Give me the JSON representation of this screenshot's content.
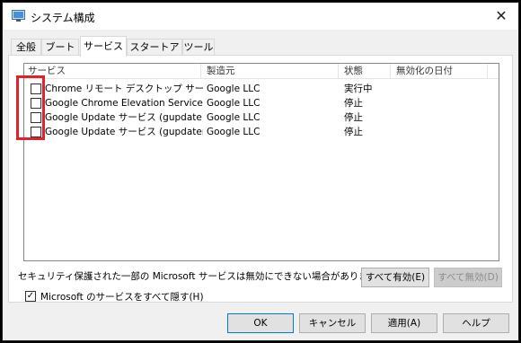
{
  "window": {
    "title": "システム構成"
  },
  "tabs": [
    {
      "label": "全般"
    },
    {
      "label": "ブート"
    },
    {
      "label": "サービス"
    },
    {
      "label": "スタートアップ"
    },
    {
      "label": "ツール"
    }
  ],
  "services": {
    "columns": [
      "サービス",
      "製造元",
      "状態",
      "無効化の日付"
    ],
    "rows": [
      {
        "name": "Chrome リモート デスクトップ サービス",
        "maker": "Google LLC",
        "status": "実行中",
        "disabled_date": "",
        "checked": false
      },
      {
        "name": "Google Chrome Elevation Service (G...",
        "maker": "Google LLC",
        "status": "停止",
        "disabled_date": "",
        "checked": false
      },
      {
        "name": "Google Update サービス (gupdate)",
        "maker": "Google LLC",
        "status": "停止",
        "disabled_date": "",
        "checked": false
      },
      {
        "name": "Google Update サービス (gupdatem)",
        "maker": "Google LLC",
        "status": "停止",
        "disabled_date": "",
        "checked": false
      }
    ]
  },
  "note": "セキュリティ保護された一部の Microsoft サービスは無効にできない場合があります。",
  "buttons": {
    "enable_all": "すべて有効(E)",
    "disable_all": "すべて無効(D)",
    "ok": "OK",
    "cancel": "キャンセル",
    "apply": "適用(A)",
    "help": "ヘルプ"
  },
  "hide_microsoft": {
    "label": "Microsoft のサービスをすべて隠す(H)",
    "checked": true
  },
  "colors": {
    "highlight": "#e0232a",
    "focus": "#0078d7"
  }
}
